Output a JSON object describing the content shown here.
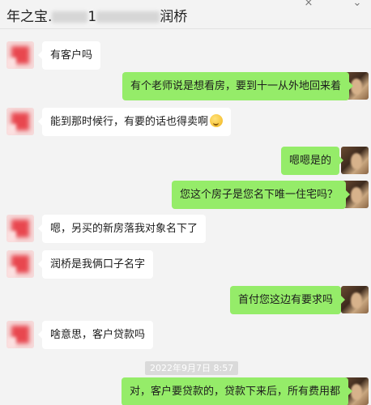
{
  "header": {
    "title_prefix": "年之宝.",
    "title_mid": "1",
    "title_name": "润桥",
    "close_icon": "×",
    "chevron_icon": "⌄"
  },
  "messages": [
    {
      "side": "left",
      "text": "有客户吗"
    },
    {
      "side": "right",
      "text": "有个老师说是想看房，要到十一从外地回来着"
    },
    {
      "side": "left",
      "text": "能到那时候行，有要的话也得卖啊",
      "emoji": "thinking-face"
    },
    {
      "side": "right",
      "text": "嗯嗯是的"
    },
    {
      "side": "right",
      "text": "您这个房子是您名下唯一住宅吗？"
    },
    {
      "side": "left",
      "text": "嗯，另买的新房落我对象名下了"
    },
    {
      "side": "left",
      "text": "润桥是我俩口子名字"
    },
    {
      "side": "right",
      "text": "首付您这边有要求吗"
    },
    {
      "side": "left",
      "text": "啥意思，客户贷款吗"
    },
    {
      "side": "right",
      "text": "对，客户要贷款的，贷款下来后，所有费用都"
    }
  ],
  "timestamp": "2022年9月7日 8:57",
  "colors": {
    "bubble_self": "#95ec69",
    "bubble_other": "#ffffff",
    "background": "#f3f3f3"
  }
}
